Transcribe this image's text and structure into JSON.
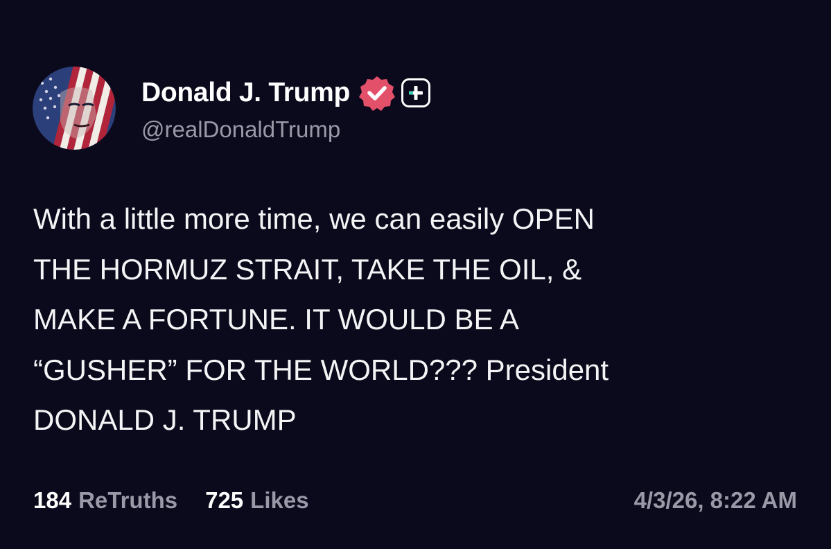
{
  "colors": {
    "background": "#0b0a1c",
    "text_primary": "#ffffff",
    "text_secondary": "#9a99a8",
    "verified_badge": "#e3506a"
  },
  "author": {
    "display_name": "Donald J. Trump",
    "handle": "@realDonaldTrump",
    "avatar_icon": "flag-portrait-avatar",
    "verified_icon": "verified-badge-icon",
    "subscription_icon": "plus-badge-icon"
  },
  "post": {
    "lines": [
      "With a little more time, we can easily OPEN",
      "THE HORMUZ STRAIT, TAKE THE OIL, &",
      "MAKE A FORTUNE. IT WOULD BE A",
      "“GUSHER” FOR THE WORLD??? President",
      "DONALD J. TRUMP"
    ]
  },
  "stats": {
    "retruths_count": "184",
    "retruths_label": "ReTruths",
    "likes_count": "725",
    "likes_label": "Likes",
    "timestamp": "4/3/26, 8:22 AM"
  }
}
